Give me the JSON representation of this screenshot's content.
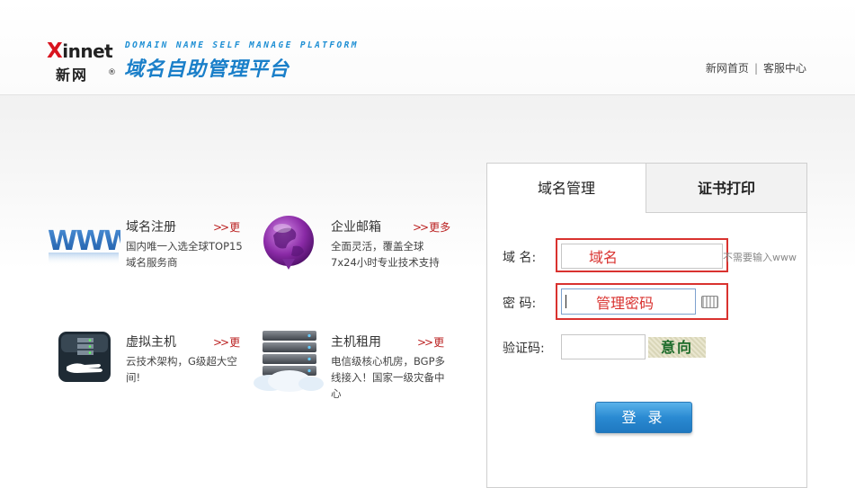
{
  "header": {
    "brand_en": "innet",
    "brand_x": "X",
    "brand_cn": "新网",
    "brand_reg": "®",
    "platform_en": "DOMAIN NAME SELF MANAGE PLATFORM",
    "platform_cn": "域名自助管理平台",
    "links": [
      {
        "label": "新网首页"
      },
      {
        "label": "客服中心"
      }
    ],
    "separator": "|"
  },
  "services": [
    {
      "icon": "www-icon",
      "title": "域名注册",
      "more": "更",
      "desc": "国内唯一入选全球TOP15域名服务商"
    },
    {
      "icon": "mail-globe-icon",
      "title": "企业邮箱",
      "more": "更多",
      "desc": "全面灵活，覆盖全球7x24小时专业技术支持"
    },
    {
      "icon": "server-hand-icon",
      "title": "虚拟主机",
      "more": "更",
      "desc": "云技术架构，G级超大空间!"
    },
    {
      "icon": "server-rack-icon",
      "title": "主机租用",
      "more": "更",
      "desc": "电信级核心机房，BGP多线接入！国家一级灾备中心"
    }
  ],
  "more_arrow": ">>",
  "login": {
    "tabs": [
      {
        "label": "域名管理",
        "active": true
      },
      {
        "label": "证书打印",
        "active": false
      }
    ],
    "domain": {
      "label": "域  名:",
      "value": "域名",
      "hint": "不需要输入www"
    },
    "password": {
      "label": "密  码:",
      "value": "管理密码"
    },
    "captcha": {
      "label": "验证码:",
      "value": "",
      "image_text": "意向"
    },
    "submit": "登 录"
  },
  "colors": {
    "accent": "#1a7fc9",
    "highlight": "#d9322f",
    "button": "#2a8ad2"
  }
}
